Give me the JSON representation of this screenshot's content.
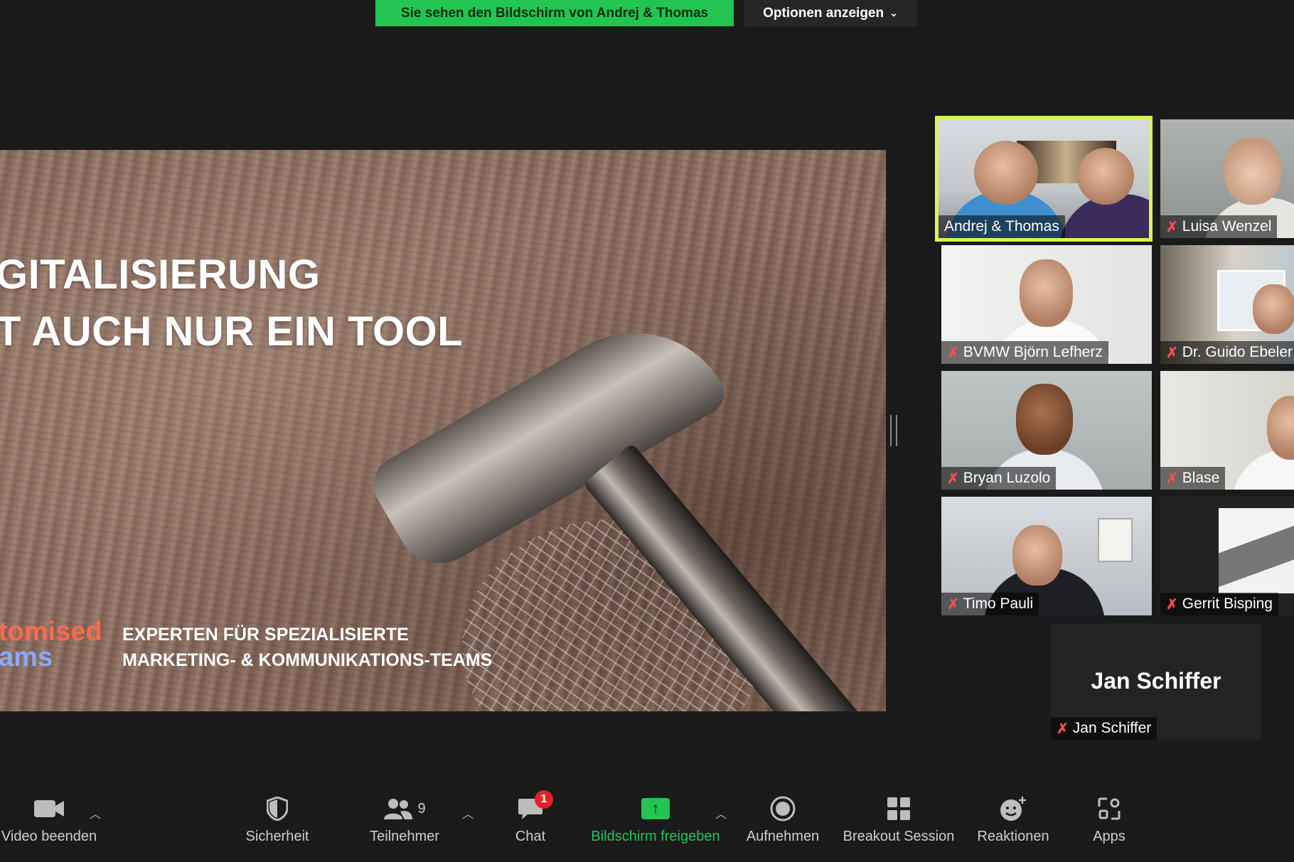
{
  "banner": {
    "sharing_text": "Sie sehen den Bildschirm von Andrej & Thomas",
    "options_label": "Optionen anzeigen",
    "options_icon": "chevron-down-icon"
  },
  "slide": {
    "title_line1": "GITALISIERUNG",
    "title_line2": "T AUCH NUR EIN TOOL",
    "brand_line1": "tomised",
    "brand_line2": "ams",
    "tagline_line1": "EXPERTEN FÜR SPEZIALISIERTE",
    "tagline_line2": "MARKETING- & KOMMUNIKATIONS-TEAMS"
  },
  "participants": [
    {
      "name": "Andrej & Thomas",
      "muted": false,
      "speaking": true
    },
    {
      "name": "Luisa Wenzel",
      "muted": true
    },
    {
      "name": "BVMW Björn Lefherz",
      "muted": true
    },
    {
      "name": "Dr. Guido Ebeler",
      "muted": true
    },
    {
      "name": "Bryan Luzolo",
      "muted": true
    },
    {
      "name": "Blase",
      "muted": true
    },
    {
      "name": "Timo Pauli",
      "muted": true
    },
    {
      "name": "Gerrit Bisping",
      "muted": true
    }
  ],
  "self_tile": {
    "display_name": "Jan Schiffer",
    "name": "Jan Schiffer",
    "muted": true
  },
  "toolbar": {
    "video": "Video beenden",
    "security": "Sicherheit",
    "participants": "Teilnehmer",
    "participants_count": "9",
    "chat": "Chat",
    "chat_badge": "1",
    "share": "Bildschirm freigeben",
    "record": "Aufnehmen",
    "breakout": "Breakout Session",
    "reactions": "Reaktionen",
    "apps": "Apps"
  },
  "colors": {
    "accent_green": "#23c552",
    "speaker_highlight": "#d8f35a",
    "mute_red": "#ff4d4d",
    "badge_red": "#e02424"
  }
}
